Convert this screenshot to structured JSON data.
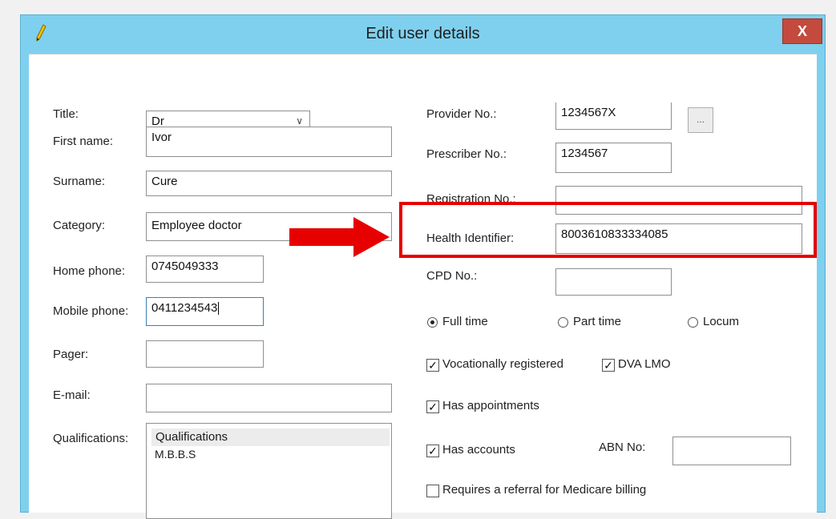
{
  "window": {
    "title": "Edit user details",
    "close_label": "X"
  },
  "left": {
    "title_label": "Title:",
    "title_value": "Dr",
    "first_name_label": "First name:",
    "first_name_value": "Ivor",
    "surname_label": "Surname:",
    "surname_value": "Cure",
    "category_label": "Category:",
    "category_value": "Employee doctor",
    "home_phone_label": "Home phone:",
    "home_phone_value": "0745049333",
    "mobile_phone_label": "Mobile phone:",
    "mobile_phone_value": "0411234543",
    "pager_label": "Pager:",
    "pager_value": "",
    "email_label": "E-mail:",
    "email_value": "",
    "qualifications_label": "Qualifications:",
    "qualifications_header": "Qualifications",
    "qualifications_items": [
      "M.B.B.S"
    ]
  },
  "right": {
    "provider_label": "Provider No.:",
    "provider_value": "1234567X",
    "browse_label": "...",
    "prescriber_label": "Prescriber No.:",
    "prescriber_value": "1234567",
    "registration_label": "Registration No.:",
    "registration_value": "",
    "health_id_label": "Health Identifier:",
    "health_id_value": "8003610833334085",
    "cpd_label": "CPD No.:",
    "cpd_value": "",
    "employment": {
      "full_time": "Full time",
      "part_time": "Part time",
      "locum": "Locum",
      "selected": "Full time"
    },
    "vocationally_registered_label": "Vocationally registered",
    "dva_lmo_label": "DVA LMO",
    "has_appointments_label": "Has appointments",
    "has_accounts_label": "Has accounts",
    "abn_label": "ABN No:",
    "abn_value": "",
    "requires_referral_label": "Requires a referral for Medicare billing"
  },
  "annotation": {
    "highlight_color": "#e60000",
    "arrow_color": "#e60000"
  },
  "colors": {
    "titlebar": "#7fd0ee",
    "close_button": "#c44a3e"
  }
}
